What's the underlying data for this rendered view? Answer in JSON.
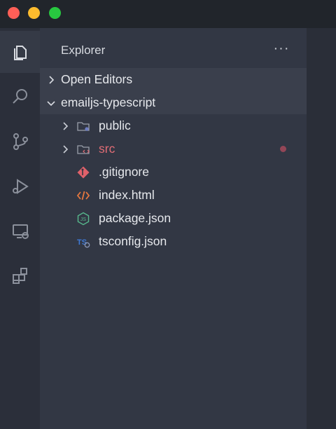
{
  "explorer": {
    "title": "Explorer",
    "more_label": "···"
  },
  "sections": {
    "open_editors": "Open Editors",
    "project": "emailjs-typescript"
  },
  "tree": [
    {
      "name": "public",
      "kind": "folder",
      "icon": "folder-public-icon"
    },
    {
      "name": "src",
      "kind": "folder",
      "icon": "folder-src-icon",
      "color": "#e06c75",
      "modified": true
    },
    {
      "name": ".gitignore",
      "kind": "file",
      "icon": "git-icon"
    },
    {
      "name": "index.html",
      "kind": "file",
      "icon": "html-icon"
    },
    {
      "name": "package.json",
      "kind": "file",
      "icon": "nodejs-icon"
    },
    {
      "name": "tsconfig.json",
      "kind": "file",
      "icon": "typescript-config-icon"
    }
  ],
  "activity_bar": [
    "files-icon",
    "search-icon",
    "source-control-icon",
    "run-debug-icon",
    "remote-explorer-icon",
    "extensions-icon"
  ],
  "colors": {
    "sidebar_bg": "#323744",
    "section_bg": "#3a3f4c",
    "text": "#e6e8ec",
    "modified_folder": "#e06c75"
  }
}
